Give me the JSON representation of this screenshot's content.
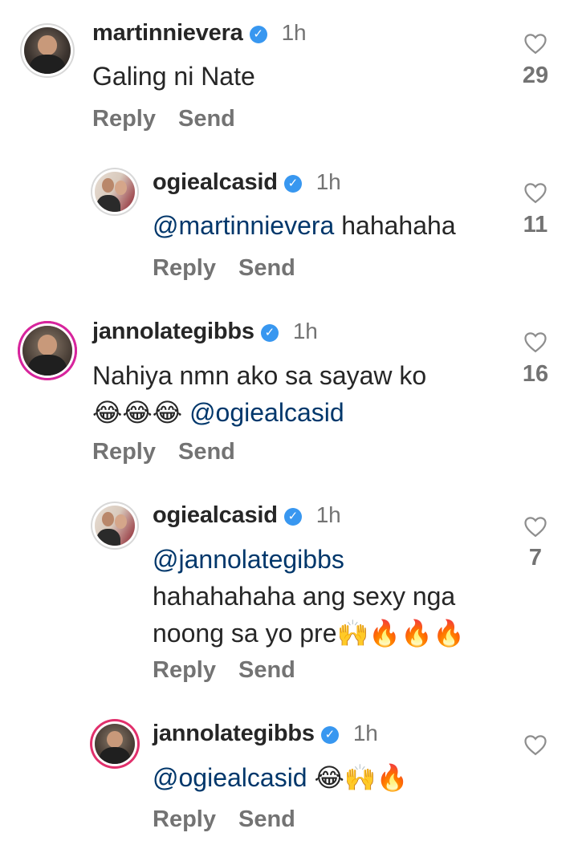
{
  "comments": [
    {
      "username": "martinnievera",
      "time": "1h",
      "lines": [
        [
          {
            "t": "Galing ni Nate",
            "m": false
          }
        ]
      ],
      "reply_label": "Reply",
      "send_label": "Send",
      "likes": "29"
    },
    {
      "username": "ogiealcasid",
      "time": "1h",
      "lines": [
        [
          {
            "t": "@martinnievera",
            "m": true
          },
          {
            "t": " hahahaha",
            "m": false
          }
        ]
      ],
      "reply_label": "Reply",
      "send_label": "Send",
      "likes": "11"
    },
    {
      "username": "jannolategibbs",
      "time": "1h",
      "lines": [
        [
          {
            "t": "Nahiya nmn ako sa sayaw ko",
            "m": false
          }
        ],
        [
          {
            "t": "😂😂😂 ",
            "m": false
          },
          {
            "t": "@ogiealcasid",
            "m": true
          }
        ]
      ],
      "reply_label": "Reply",
      "send_label": "Send",
      "likes": "16"
    },
    {
      "username": "ogiealcasid",
      "time": "1h",
      "lines": [
        [
          {
            "t": "@jannolategibbs",
            "m": true
          }
        ],
        [
          {
            "t": "hahahahaha ang sexy nga",
            "m": false
          }
        ],
        [
          {
            "t": "noong sa yo pre🙌🔥🔥🔥",
            "m": false
          }
        ]
      ],
      "reply_label": "Reply",
      "send_label": "Send",
      "likes": "7"
    },
    {
      "username": "jannolategibbs",
      "time": "1h",
      "lines": [
        [
          {
            "t": "@ogiealcasid",
            "m": true
          },
          {
            "t": " 😂🙌🔥",
            "m": false
          }
        ]
      ],
      "reply_label": "Reply",
      "send_label": "Send",
      "likes": ""
    }
  ],
  "icons": {
    "verified": "verified-badge-icon",
    "like": "heart-outline-icon"
  },
  "colors": {
    "verified": "#3897f0",
    "mention": "#00376b",
    "muted": "#737373"
  }
}
